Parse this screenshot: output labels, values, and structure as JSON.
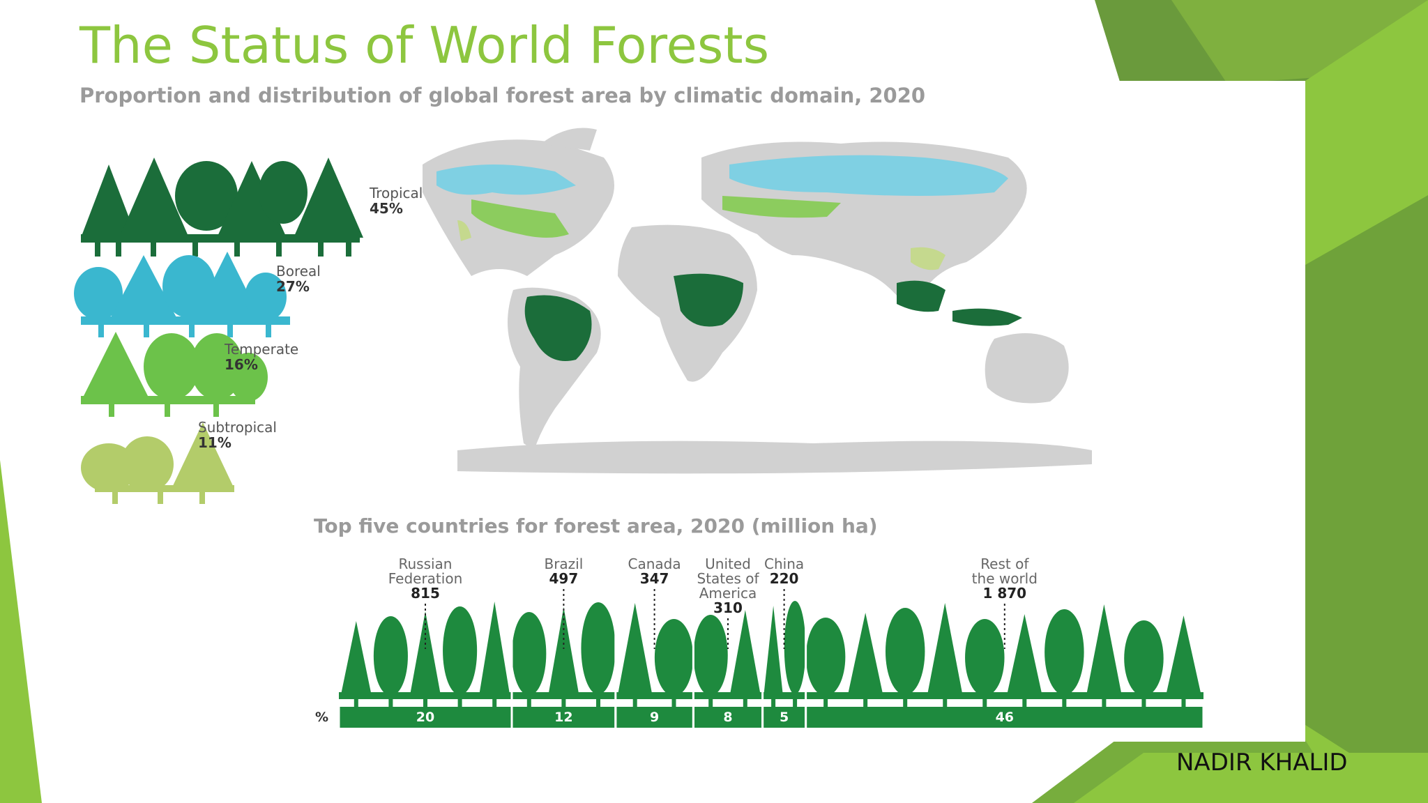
{
  "slide": {
    "title": "The Status of World Forests",
    "author": "NADIR KHALID",
    "accent_color": "#8dc63f"
  },
  "infographic": {
    "subtitle": "Proportion and distribution of global forest area by climatic domain, 2020",
    "legend": [
      {
        "label": "Tropical",
        "value": "45%",
        "color": "#1b6d3a"
      },
      {
        "label": "Boreal",
        "value": "27%",
        "color": "#3ab7cf"
      },
      {
        "label": "Temperate",
        "value": "16%",
        "color": "#6cc24a"
      },
      {
        "label": "Subtropical",
        "value": "11%",
        "color": "#b3cc6a"
      }
    ],
    "bar_title": "Top five countries for forest area, 2020 (million ha)",
    "percent_label": "%"
  },
  "chart_data": {
    "type": "bar",
    "title": "Top five countries for forest area, 2020 (million ha)",
    "categories": [
      "Russian Federation",
      "Brazil",
      "Canada",
      "United States of America",
      "China",
      "Rest of the world"
    ],
    "category_lines": [
      [
        "Russian",
        "Federation"
      ],
      [
        "Brazil"
      ],
      [
        "Canada"
      ],
      [
        "United",
        "States of",
        "America"
      ],
      [
        "China"
      ],
      [
        "Rest of",
        "the world"
      ]
    ],
    "values": [
      815,
      497,
      347,
      310,
      220,
      1870
    ],
    "value_labels": [
      "815",
      "497",
      "347",
      "310",
      "220",
      "1 870"
    ],
    "percent": [
      20,
      12,
      9,
      8,
      5,
      46
    ],
    "unit": "million ha",
    "bar_color": "#1e8a3e"
  }
}
